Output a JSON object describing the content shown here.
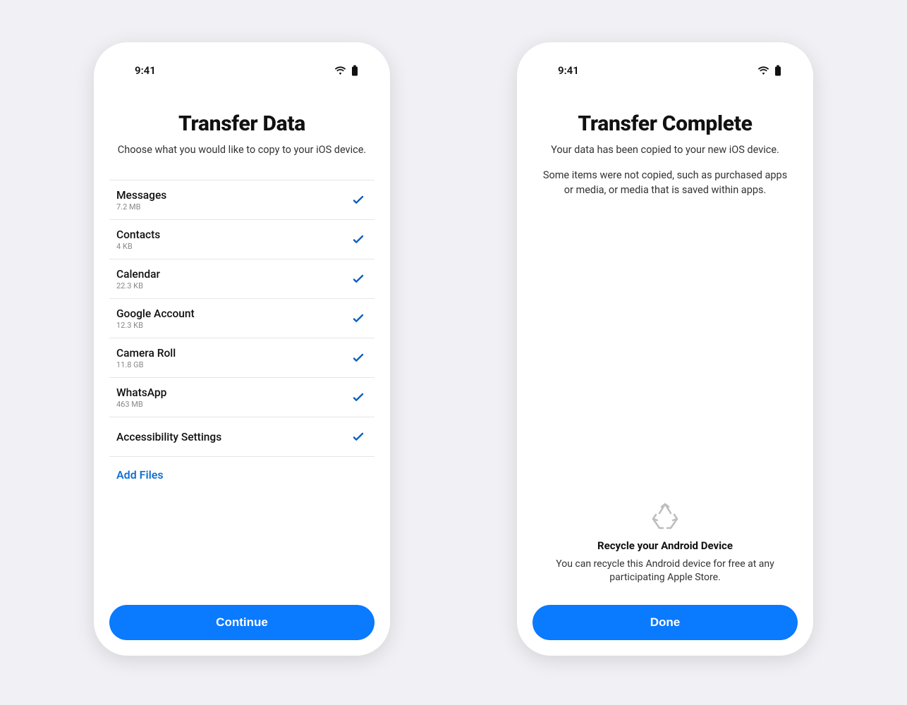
{
  "statusbar": {
    "time": "9:41"
  },
  "screen1": {
    "title": "Transfer Data",
    "subtitle": "Choose what you would like to copy to your iOS device.",
    "items": [
      {
        "label": "Messages",
        "sub": "7.2 MB"
      },
      {
        "label": "Contacts",
        "sub": "4 KB"
      },
      {
        "label": "Calendar",
        "sub": "22.3 KB"
      },
      {
        "label": "Google Account",
        "sub": "12.3 KB"
      },
      {
        "label": "Camera Roll",
        "sub": "11.8 GB"
      },
      {
        "label": "WhatsApp",
        "sub": "463 MB"
      },
      {
        "label": "Accessibility Settings",
        "sub": ""
      }
    ],
    "add_files_label": "Add Files",
    "continue_label": "Continue"
  },
  "screen2": {
    "title": "Transfer Complete",
    "subtitle1": "Your data has been copied to your new iOS device.",
    "subtitle2": "Some items were not copied, such as purchased apps or media, or media that is saved within apps.",
    "recycle_title": "Recycle your Android Device",
    "recycle_desc": "You can recycle this Android device for free at any participating Apple Store.",
    "done_label": "Done"
  }
}
